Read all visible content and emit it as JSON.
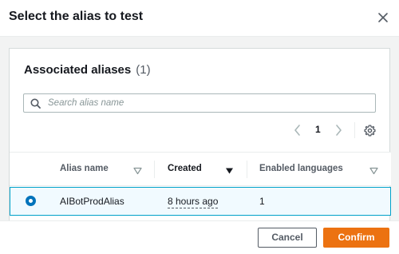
{
  "modal": {
    "title": "Select the alias to test"
  },
  "section": {
    "title": "Associated aliases",
    "count": "(1)"
  },
  "search": {
    "placeholder": "Search alias name",
    "value": ""
  },
  "pagination": {
    "current_page": "1"
  },
  "table": {
    "columns": [
      {
        "label": "Alias name",
        "sort": "sortable"
      },
      {
        "label": "Created",
        "sort": "sorted-descending"
      },
      {
        "label": "Enabled languages",
        "sort": "sortable"
      }
    ],
    "rows": [
      {
        "selected": true,
        "alias_name": "AIBotProdAlias",
        "created": "8 hours ago",
        "enabled_languages": "1"
      }
    ]
  },
  "footer": {
    "cancel_label": "Cancel",
    "confirm_label": "Confirm"
  },
  "colors": {
    "primary_button": "#ec7211",
    "selected_row_bg": "#f1faff",
    "selected_row_border": "#00a1c9",
    "radio": "#0073bb"
  },
  "icons": {
    "close": "close-icon",
    "search": "search-icon",
    "prev": "chevron-left-icon",
    "next": "chevron-right-icon",
    "settings": "gear-icon",
    "sort": "caret-down-icon"
  }
}
